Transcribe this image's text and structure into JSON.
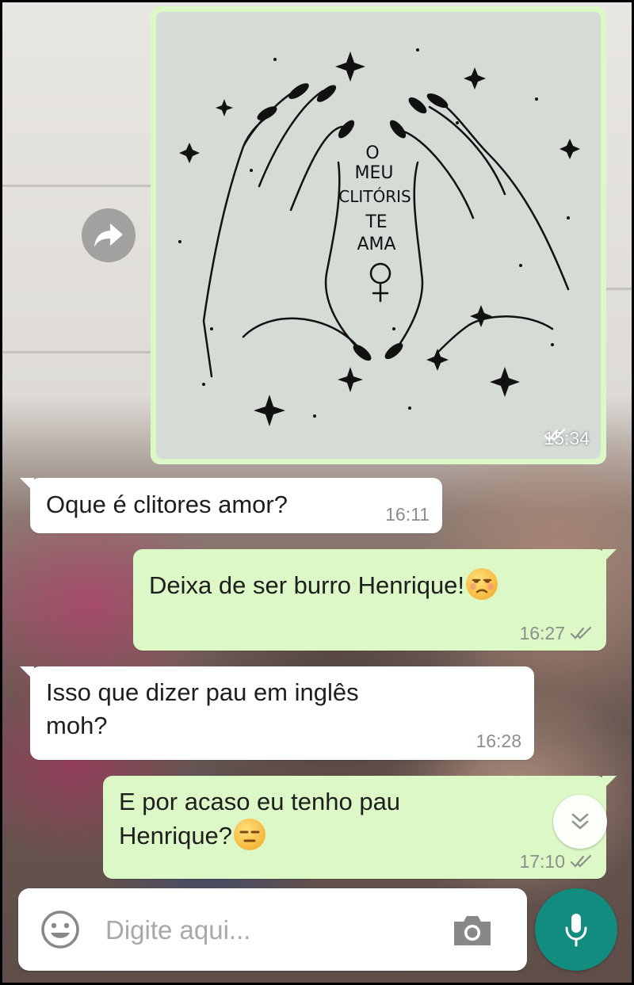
{
  "chat": {
    "image_message": {
      "caption_art": [
        "O",
        "MEU",
        "CLITÓRIS",
        "TE",
        "AMA"
      ],
      "time": "15:34",
      "status_icon": "double-check-icon"
    },
    "messages": [
      {
        "direction": "incoming",
        "text": "Oque é clitores amor?",
        "time": "16:11"
      },
      {
        "direction": "outgoing",
        "text": "Deixa de ser burro Henrique!",
        "emoji": "unamused-face",
        "time": "16:27",
        "status_icon": "double-check-icon"
      },
      {
        "direction": "incoming",
        "line1": "Isso que dizer pau em inglês",
        "line2": "moh?",
        "time": "16:28"
      },
      {
        "direction": "outgoing",
        "line1": "E por acaso eu tenho pau",
        "line2": "Henrique?",
        "emoji": "expressionless-face",
        "time": "17:10",
        "status_icon": "double-check-icon"
      }
    ]
  },
  "composer": {
    "placeholder": "Digite aqui...",
    "emoji_icon": "smiley-icon",
    "camera_icon": "camera-icon",
    "mic_icon": "microphone-icon"
  },
  "colors": {
    "outgoing_bubble": "#dcf8c6",
    "incoming_bubble": "#ffffff",
    "mic_button": "#128c7e",
    "timestamp": "#8a8f8a"
  }
}
